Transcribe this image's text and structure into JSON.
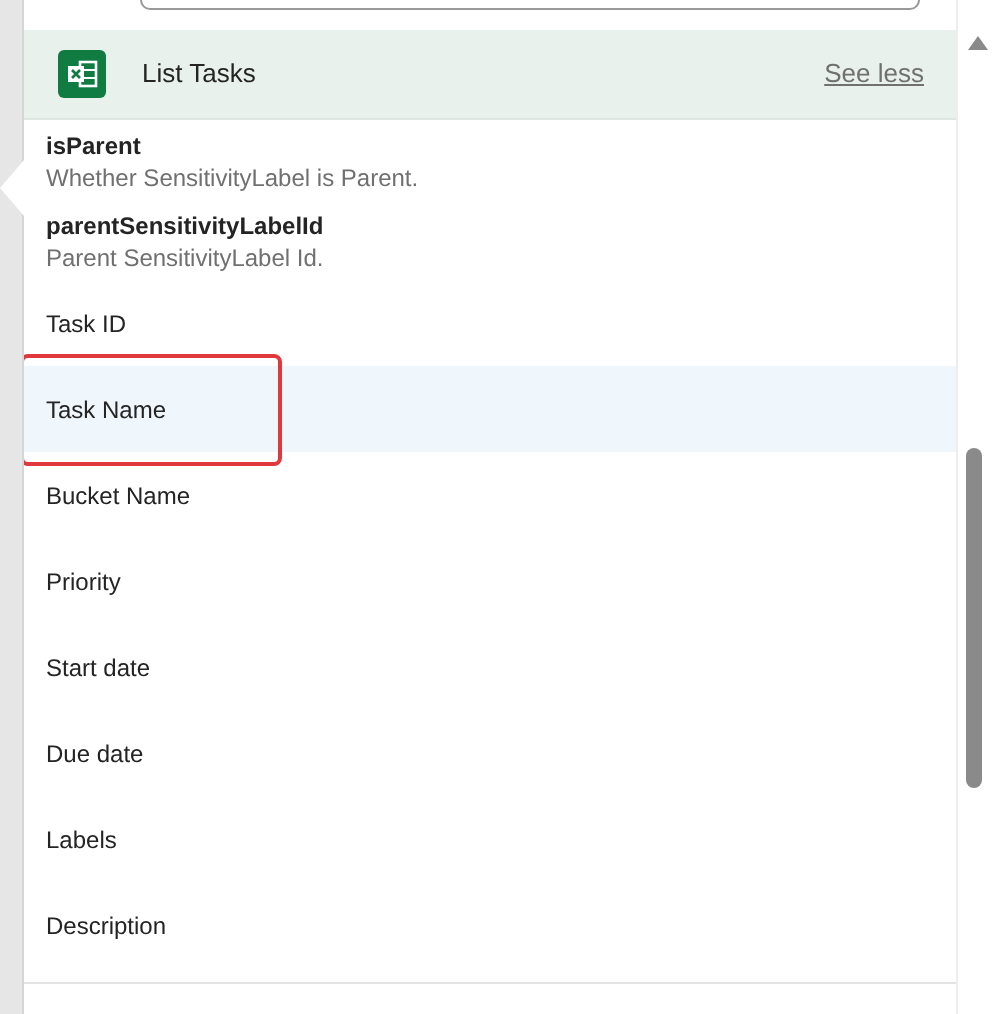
{
  "section": {
    "title": "List Tasks",
    "toggle": "See less"
  },
  "fields": [
    {
      "name": "isParent",
      "description": "Whether SensitivityLabel is Parent.",
      "selected": false,
      "annotated": false
    },
    {
      "name": "parentSensitivityLabelId",
      "description": "Parent SensitivityLabel Id.",
      "selected": false,
      "annotated": false
    },
    {
      "name": "Task ID",
      "selected": false,
      "annotated": false
    },
    {
      "name": "Task Name",
      "selected": true,
      "annotated": true
    },
    {
      "name": "Bucket Name",
      "selected": false,
      "annotated": false
    },
    {
      "name": "Priority",
      "selected": false,
      "annotated": false
    },
    {
      "name": "Start date",
      "selected": false,
      "annotated": false
    },
    {
      "name": "Due date",
      "selected": false,
      "annotated": false
    },
    {
      "name": "Labels",
      "selected": false,
      "annotated": false
    },
    {
      "name": "Description",
      "selected": false,
      "annotated": false
    }
  ]
}
